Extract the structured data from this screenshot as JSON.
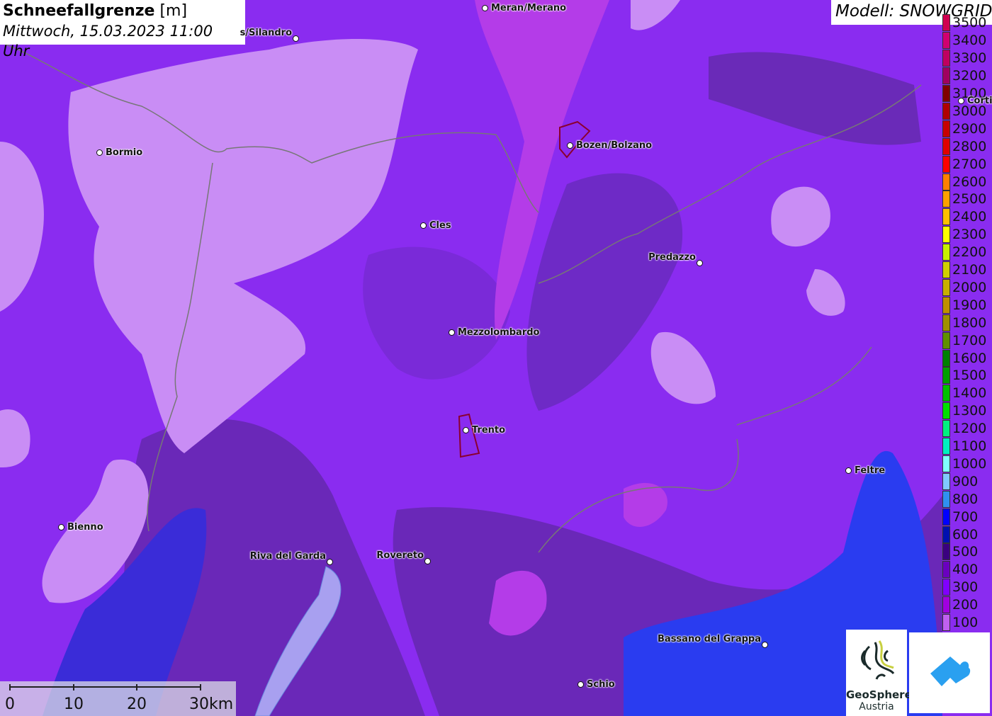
{
  "title": {
    "main": "Schneefallgrenze",
    "unit": "[m]",
    "date": "Mittwoch, 15.03.2023 11:00 Uhr"
  },
  "model": "Modell: SNOWGRID",
  "legend": {
    "entries": [
      {
        "label": "100",
        "color": "#c060f0"
      },
      {
        "label": "200",
        "color": "#a000e0"
      },
      {
        "label": "300",
        "color": "#8000ff"
      },
      {
        "label": "400",
        "color": "#6a00c0"
      },
      {
        "label": "500",
        "color": "#3a0080"
      },
      {
        "label": "600",
        "color": "#0010b0"
      },
      {
        "label": "700",
        "color": "#0000ff"
      },
      {
        "label": "800",
        "color": "#3090f0"
      },
      {
        "label": "900",
        "color": "#80c8ff"
      },
      {
        "label": "1000",
        "color": "#80ffff"
      },
      {
        "label": "1100",
        "color": "#00f0c0"
      },
      {
        "label": "1200",
        "color": "#00f080"
      },
      {
        "label": "1300",
        "color": "#00e000"
      },
      {
        "label": "1400",
        "color": "#00c000"
      },
      {
        "label": "1500",
        "color": "#00a000"
      },
      {
        "label": "1600",
        "color": "#008000"
      },
      {
        "label": "1700",
        "color": "#609000"
      },
      {
        "label": "1800",
        "color": "#a09000"
      },
      {
        "label": "1900",
        "color": "#c09000"
      },
      {
        "label": "2000",
        "color": "#c8b000"
      },
      {
        "label": "2100",
        "color": "#d0d000"
      },
      {
        "label": "2200",
        "color": "#c8f000"
      },
      {
        "label": "2300",
        "color": "#ffff00"
      },
      {
        "label": "2400",
        "color": "#ffc000"
      },
      {
        "label": "2500",
        "color": "#ffa000"
      },
      {
        "label": "2600",
        "color": "#ff8000"
      },
      {
        "label": "2700",
        "color": "#ff0000"
      },
      {
        "label": "2800",
        "color": "#e00000"
      },
      {
        "label": "2900",
        "color": "#c80000"
      },
      {
        "label": "3000",
        "color": "#b00000"
      },
      {
        "label": "3100",
        "color": "#800000"
      },
      {
        "label": "3200",
        "color": "#a00060"
      },
      {
        "label": "3300",
        "color": "#c00060"
      },
      {
        "label": "3400",
        "color": "#d00070"
      },
      {
        "label": "3500",
        "color": "#d00050"
      }
    ]
  },
  "cities": [
    {
      "name": "Meran/Merano"
    },
    {
      "name": "s/Silandro"
    },
    {
      "name": "Bormio"
    },
    {
      "name": "Bozen/Bolzano"
    },
    {
      "name": "Cles"
    },
    {
      "name": "Predazzo"
    },
    {
      "name": "Mezzolombardo"
    },
    {
      "name": "Trento"
    },
    {
      "name": "Feltre"
    },
    {
      "name": "Bienno"
    },
    {
      "name": "Riva del Garda"
    },
    {
      "name": "Rovereto"
    },
    {
      "name": "Bassano del Grappa"
    },
    {
      "name": "Schio"
    },
    {
      "name": "Cortina"
    }
  ],
  "scale": {
    "labels": [
      "0",
      "10",
      "20",
      "30km"
    ]
  },
  "logos": {
    "geosphere": "GeoSphere Austria",
    "geosphere_line1": "GeoSphere",
    "geosphere_line2": "Austria"
  }
}
